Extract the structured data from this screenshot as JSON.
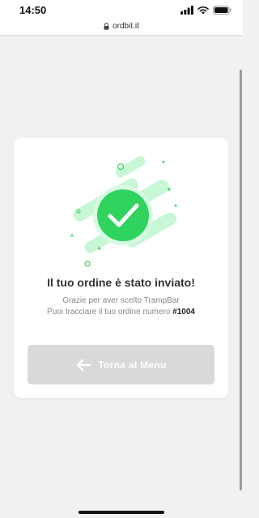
{
  "status_bar": {
    "time": "14:50",
    "icons": [
      "cellular-signal-icon",
      "wifi-icon",
      "battery-icon"
    ]
  },
  "browser": {
    "url": "ordbit.it",
    "lock_icon": "lock-icon"
  },
  "confirmation": {
    "icon": "success-checkmark-icon",
    "title": "Il tuo ordine è stato inviato!",
    "thanks": "Grazie per aver scelto TrampBar",
    "track_text": "Puoi tracciare il tuo ordine numero",
    "order_number": "#1004",
    "button_label": "Torna al Menu",
    "button_icon": "arrow-left-icon"
  },
  "colors": {
    "accent_green": "#2fd35d",
    "light_green": "#c7f7d6",
    "button_disabled": "#d9d9d9"
  }
}
